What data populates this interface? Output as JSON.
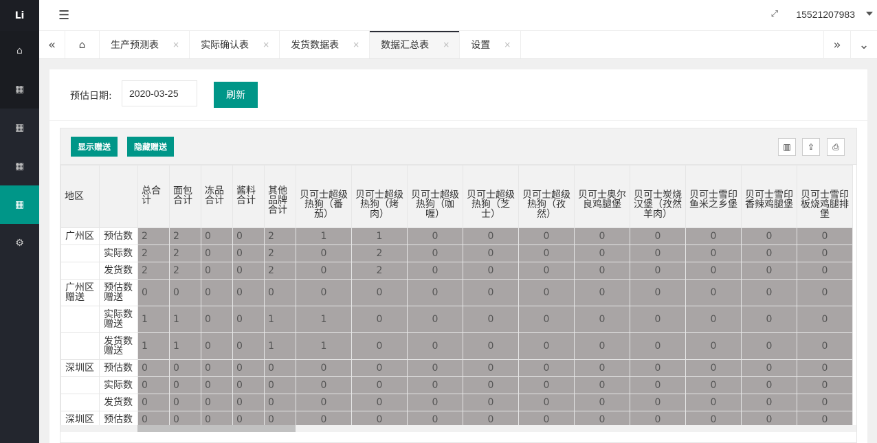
{
  "sidebar": {
    "logo": "Li",
    "items": [
      {
        "icon": "home-icon",
        "glyph": "⌂"
      },
      {
        "icon": "table-icon",
        "glyph": "▦"
      },
      {
        "icon": "table-icon",
        "glyph": "▦"
      },
      {
        "icon": "table-icon",
        "glyph": "▦"
      },
      {
        "icon": "table-icon",
        "glyph": "▦"
      },
      {
        "icon": "gear-icon",
        "glyph": "⚙"
      }
    ]
  },
  "topbar": {
    "menu_glyph": "☰",
    "fullscreen_glyph": "⤢",
    "username": "15521207983"
  },
  "tabs": {
    "prev_glyph": "«",
    "home_glyph": "⌂",
    "next_glyph": "»",
    "more_glyph": "⌄",
    "close_glyph": "×",
    "items": [
      {
        "label": "生产预测表"
      },
      {
        "label": "实际确认表"
      },
      {
        "label": "发货数据表"
      },
      {
        "label": "数据汇总表"
      },
      {
        "label": "设置"
      }
    ],
    "active_index": 3
  },
  "filter": {
    "label": "预估日期:",
    "date_value": "2020-03-25",
    "refresh_label": "刷新"
  },
  "toolbar": {
    "show_gift_label": "显示赠送",
    "hide_gift_label": "隐藏赠送",
    "columns_glyph": "▥",
    "export_glyph": "⇪",
    "print_glyph": "⎙"
  },
  "table": {
    "headers": [
      "地区",
      "",
      "总合计",
      "面包合计",
      "冻品合计",
      "酱料合计",
      "其他品牌合计",
      "贝可士超级热狗（番茄）",
      "贝可士超级热狗（烤肉）",
      "贝可士超级热狗（咖喱）",
      "贝可士超级热狗（芝士）",
      "贝可士超级热狗（孜然）",
      "贝可士奥尔良鸡腿堡",
      "贝可士炭烧汉堡（孜然羊肉）",
      "贝可士雪印鱼米之乡堡",
      "贝可士雪印香辣鸡腿堡",
      "贝可士雪印板烧鸡腿排堡"
    ],
    "rows": [
      {
        "region": "广州区",
        "type": "预估数",
        "vals": [
          "2",
          "2",
          "0",
          "0",
          "2",
          "1",
          "1",
          "0",
          "0",
          "0",
          "0",
          "0",
          "0",
          "0",
          "0"
        ]
      },
      {
        "region": "",
        "type": "实际数",
        "vals": [
          "2",
          "2",
          "0",
          "0",
          "2",
          "0",
          "2",
          "0",
          "0",
          "0",
          "0",
          "0",
          "0",
          "0",
          "0"
        ]
      },
      {
        "region": "",
        "type": "发货数",
        "vals": [
          "2",
          "2",
          "0",
          "0",
          "2",
          "0",
          "2",
          "0",
          "0",
          "0",
          "0",
          "0",
          "0",
          "0",
          "0"
        ]
      },
      {
        "region": "广州区赠送",
        "type": "预估数赠送",
        "vals": [
          "0",
          "0",
          "0",
          "0",
          "0",
          "0",
          "0",
          "0",
          "0",
          "0",
          "0",
          "0",
          "0",
          "0",
          "0"
        ]
      },
      {
        "region": "",
        "type": "实际数赠送",
        "vals": [
          "1",
          "1",
          "0",
          "0",
          "1",
          "1",
          "0",
          "0",
          "0",
          "0",
          "0",
          "0",
          "0",
          "0",
          "0"
        ]
      },
      {
        "region": "",
        "type": "发货数赠送",
        "vals": [
          "1",
          "1",
          "0",
          "0",
          "1",
          "1",
          "0",
          "0",
          "0",
          "0",
          "0",
          "0",
          "0",
          "0",
          "0"
        ]
      },
      {
        "region": "深圳区",
        "type": "预估数",
        "vals": [
          "0",
          "0",
          "0",
          "0",
          "0",
          "0",
          "0",
          "0",
          "0",
          "0",
          "0",
          "0",
          "0",
          "0",
          "0"
        ]
      },
      {
        "region": "",
        "type": "实际数",
        "vals": [
          "0",
          "0",
          "0",
          "0",
          "0",
          "0",
          "0",
          "0",
          "0",
          "0",
          "0",
          "0",
          "0",
          "0",
          "0"
        ]
      },
      {
        "region": "",
        "type": "发货数",
        "vals": [
          "0",
          "0",
          "0",
          "0",
          "0",
          "0",
          "0",
          "0",
          "0",
          "0",
          "0",
          "0",
          "0",
          "0",
          "0"
        ]
      },
      {
        "region": "深圳区",
        "type": "预估数",
        "vals": [
          "0",
          "0",
          "0",
          "0",
          "0",
          "0",
          "0",
          "0",
          "0",
          "0",
          "0",
          "0",
          "0",
          "0",
          "0"
        ]
      }
    ]
  }
}
